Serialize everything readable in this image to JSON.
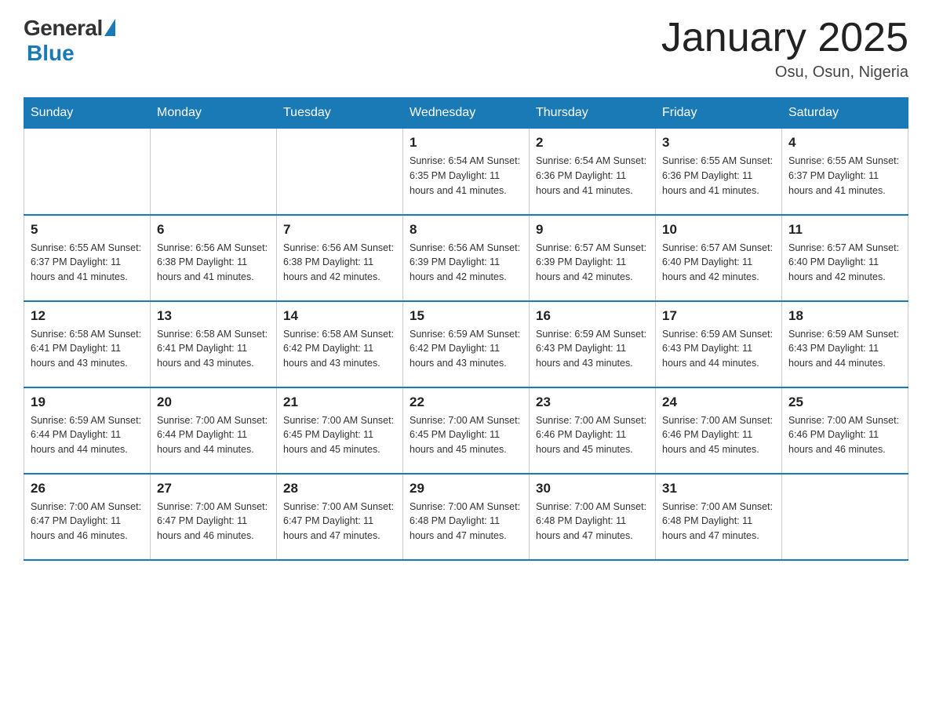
{
  "logo": {
    "general": "General",
    "blue": "Blue"
  },
  "title": "January 2025",
  "location": "Osu, Osun, Nigeria",
  "days_of_week": [
    "Sunday",
    "Monday",
    "Tuesday",
    "Wednesday",
    "Thursday",
    "Friday",
    "Saturday"
  ],
  "weeks": [
    [
      {
        "day": "",
        "info": ""
      },
      {
        "day": "",
        "info": ""
      },
      {
        "day": "",
        "info": ""
      },
      {
        "day": "1",
        "info": "Sunrise: 6:54 AM\nSunset: 6:35 PM\nDaylight: 11 hours and 41 minutes."
      },
      {
        "day": "2",
        "info": "Sunrise: 6:54 AM\nSunset: 6:36 PM\nDaylight: 11 hours and 41 minutes."
      },
      {
        "day": "3",
        "info": "Sunrise: 6:55 AM\nSunset: 6:36 PM\nDaylight: 11 hours and 41 minutes."
      },
      {
        "day": "4",
        "info": "Sunrise: 6:55 AM\nSunset: 6:37 PM\nDaylight: 11 hours and 41 minutes."
      }
    ],
    [
      {
        "day": "5",
        "info": "Sunrise: 6:55 AM\nSunset: 6:37 PM\nDaylight: 11 hours and 41 minutes."
      },
      {
        "day": "6",
        "info": "Sunrise: 6:56 AM\nSunset: 6:38 PM\nDaylight: 11 hours and 41 minutes."
      },
      {
        "day": "7",
        "info": "Sunrise: 6:56 AM\nSunset: 6:38 PM\nDaylight: 11 hours and 42 minutes."
      },
      {
        "day": "8",
        "info": "Sunrise: 6:56 AM\nSunset: 6:39 PM\nDaylight: 11 hours and 42 minutes."
      },
      {
        "day": "9",
        "info": "Sunrise: 6:57 AM\nSunset: 6:39 PM\nDaylight: 11 hours and 42 minutes."
      },
      {
        "day": "10",
        "info": "Sunrise: 6:57 AM\nSunset: 6:40 PM\nDaylight: 11 hours and 42 minutes."
      },
      {
        "day": "11",
        "info": "Sunrise: 6:57 AM\nSunset: 6:40 PM\nDaylight: 11 hours and 42 minutes."
      }
    ],
    [
      {
        "day": "12",
        "info": "Sunrise: 6:58 AM\nSunset: 6:41 PM\nDaylight: 11 hours and 43 minutes."
      },
      {
        "day": "13",
        "info": "Sunrise: 6:58 AM\nSunset: 6:41 PM\nDaylight: 11 hours and 43 minutes."
      },
      {
        "day": "14",
        "info": "Sunrise: 6:58 AM\nSunset: 6:42 PM\nDaylight: 11 hours and 43 minutes."
      },
      {
        "day": "15",
        "info": "Sunrise: 6:59 AM\nSunset: 6:42 PM\nDaylight: 11 hours and 43 minutes."
      },
      {
        "day": "16",
        "info": "Sunrise: 6:59 AM\nSunset: 6:43 PM\nDaylight: 11 hours and 43 minutes."
      },
      {
        "day": "17",
        "info": "Sunrise: 6:59 AM\nSunset: 6:43 PM\nDaylight: 11 hours and 44 minutes."
      },
      {
        "day": "18",
        "info": "Sunrise: 6:59 AM\nSunset: 6:43 PM\nDaylight: 11 hours and 44 minutes."
      }
    ],
    [
      {
        "day": "19",
        "info": "Sunrise: 6:59 AM\nSunset: 6:44 PM\nDaylight: 11 hours and 44 minutes."
      },
      {
        "day": "20",
        "info": "Sunrise: 7:00 AM\nSunset: 6:44 PM\nDaylight: 11 hours and 44 minutes."
      },
      {
        "day": "21",
        "info": "Sunrise: 7:00 AM\nSunset: 6:45 PM\nDaylight: 11 hours and 45 minutes."
      },
      {
        "day": "22",
        "info": "Sunrise: 7:00 AM\nSunset: 6:45 PM\nDaylight: 11 hours and 45 minutes."
      },
      {
        "day": "23",
        "info": "Sunrise: 7:00 AM\nSunset: 6:46 PM\nDaylight: 11 hours and 45 minutes."
      },
      {
        "day": "24",
        "info": "Sunrise: 7:00 AM\nSunset: 6:46 PM\nDaylight: 11 hours and 45 minutes."
      },
      {
        "day": "25",
        "info": "Sunrise: 7:00 AM\nSunset: 6:46 PM\nDaylight: 11 hours and 46 minutes."
      }
    ],
    [
      {
        "day": "26",
        "info": "Sunrise: 7:00 AM\nSunset: 6:47 PM\nDaylight: 11 hours and 46 minutes."
      },
      {
        "day": "27",
        "info": "Sunrise: 7:00 AM\nSunset: 6:47 PM\nDaylight: 11 hours and 46 minutes."
      },
      {
        "day": "28",
        "info": "Sunrise: 7:00 AM\nSunset: 6:47 PM\nDaylight: 11 hours and 47 minutes."
      },
      {
        "day": "29",
        "info": "Sunrise: 7:00 AM\nSunset: 6:48 PM\nDaylight: 11 hours and 47 minutes."
      },
      {
        "day": "30",
        "info": "Sunrise: 7:00 AM\nSunset: 6:48 PM\nDaylight: 11 hours and 47 minutes."
      },
      {
        "day": "31",
        "info": "Sunrise: 7:00 AM\nSunset: 6:48 PM\nDaylight: 11 hours and 47 minutes."
      },
      {
        "day": "",
        "info": ""
      }
    ]
  ]
}
